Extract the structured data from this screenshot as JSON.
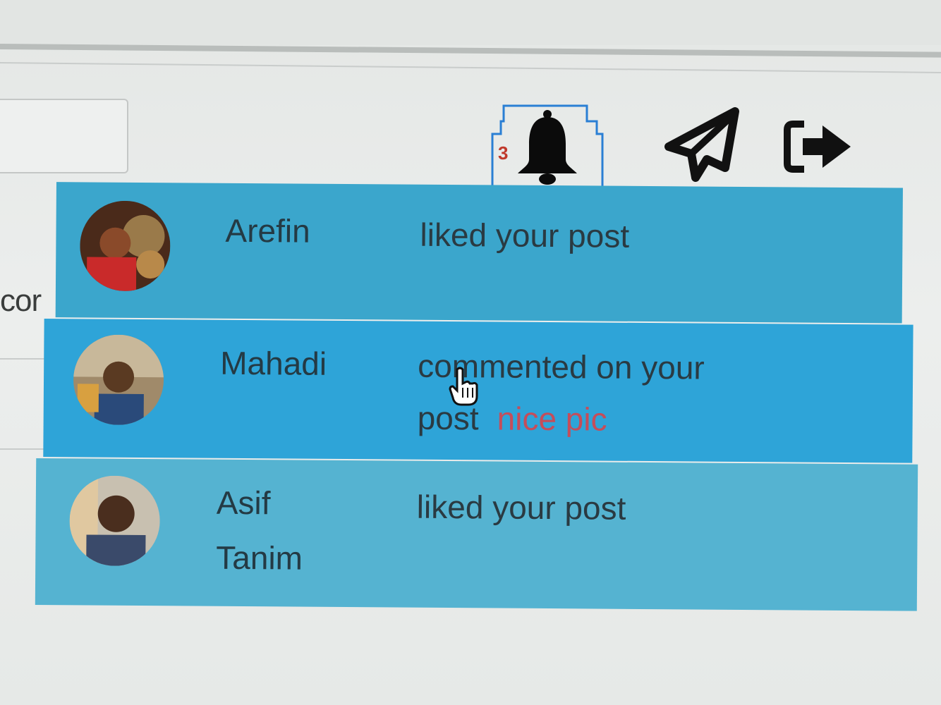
{
  "header": {
    "notification_count": "3",
    "icons": [
      "bell-icon",
      "send-icon",
      "logout-icon"
    ]
  },
  "sidebar": {
    "clipped_text": "cor"
  },
  "notifications": [
    {
      "name": "Arefin",
      "action": "liked your post",
      "comment": ""
    },
    {
      "name": "Mahadi",
      "action": "commented on your post",
      "comment": "nice pic"
    },
    {
      "name": "Asif Tanim",
      "action": "liked your post",
      "comment": ""
    }
  ],
  "colors": {
    "row_1": "#3ba6cc",
    "row_2_hover": "#2ea4d8",
    "row_3": "#55b3d1",
    "comment_text": "#c54d5a",
    "badge": "#c0392b",
    "focus_outline": "#2a7fd4"
  }
}
